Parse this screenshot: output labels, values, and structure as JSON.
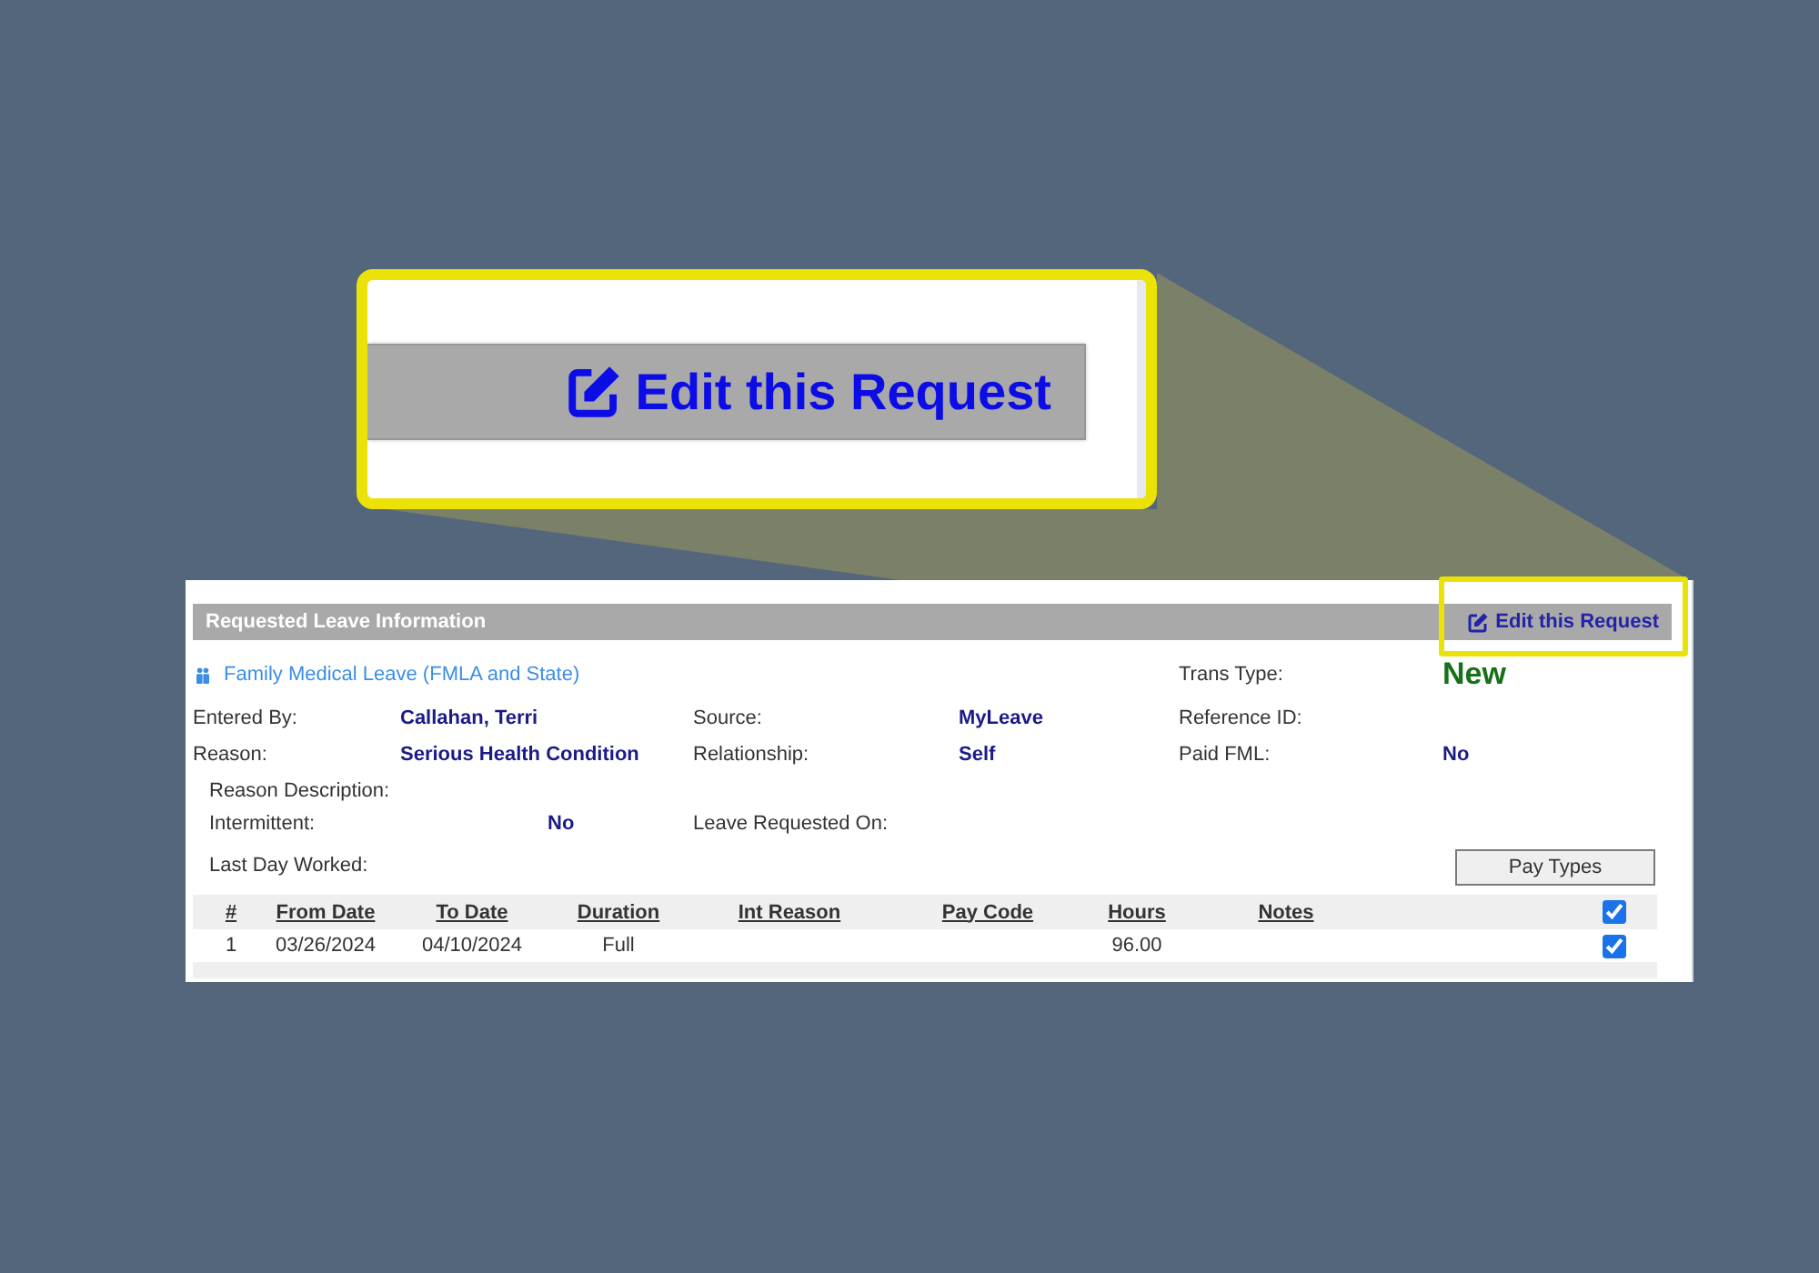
{
  "callout": {
    "text": "Edit this Request"
  },
  "panel": {
    "title": "Requested Leave Information",
    "edit_link": "Edit this Request",
    "leave_type": "Family Medical Leave (FMLA and State)",
    "trans_type": {
      "label": "Trans Type:",
      "value": "New"
    },
    "fields": [
      [
        {
          "label": "Entered By:",
          "value": "Callahan, Terri"
        },
        {
          "label": "Source:",
          "value": "MyLeave"
        },
        {
          "label": "Reference ID:"
        }
      ],
      [
        {
          "label": "Reason:",
          "value": "Serious Health Condition"
        },
        {
          "label": "Relationship:",
          "value": "Self"
        },
        {
          "label": "Paid FML:",
          "value": "No"
        }
      ]
    ],
    "sub_fields": [
      [
        {
          "label": "Reason Description:"
        }
      ],
      [
        {
          "label": "Intermittent:",
          "value": "No"
        },
        {
          "label": "Leave Requested On:"
        }
      ],
      [
        {
          "label": "Last Day Worked:"
        }
      ]
    ],
    "pay_types_button": "Pay Types",
    "table": {
      "columns": [
        "#",
        "From Date",
        "To Date",
        "Duration",
        "Int Reason",
        "Pay Code",
        "Hours",
        "Notes"
      ],
      "select_all": {
        "checked": true
      },
      "rows": [
        {
          "number": "1",
          "from_date": "03/26/2024",
          "to_date": "04/10/2024",
          "duration": "Full",
          "hours": "96.00",
          "checked": true
        }
      ]
    }
  }
}
